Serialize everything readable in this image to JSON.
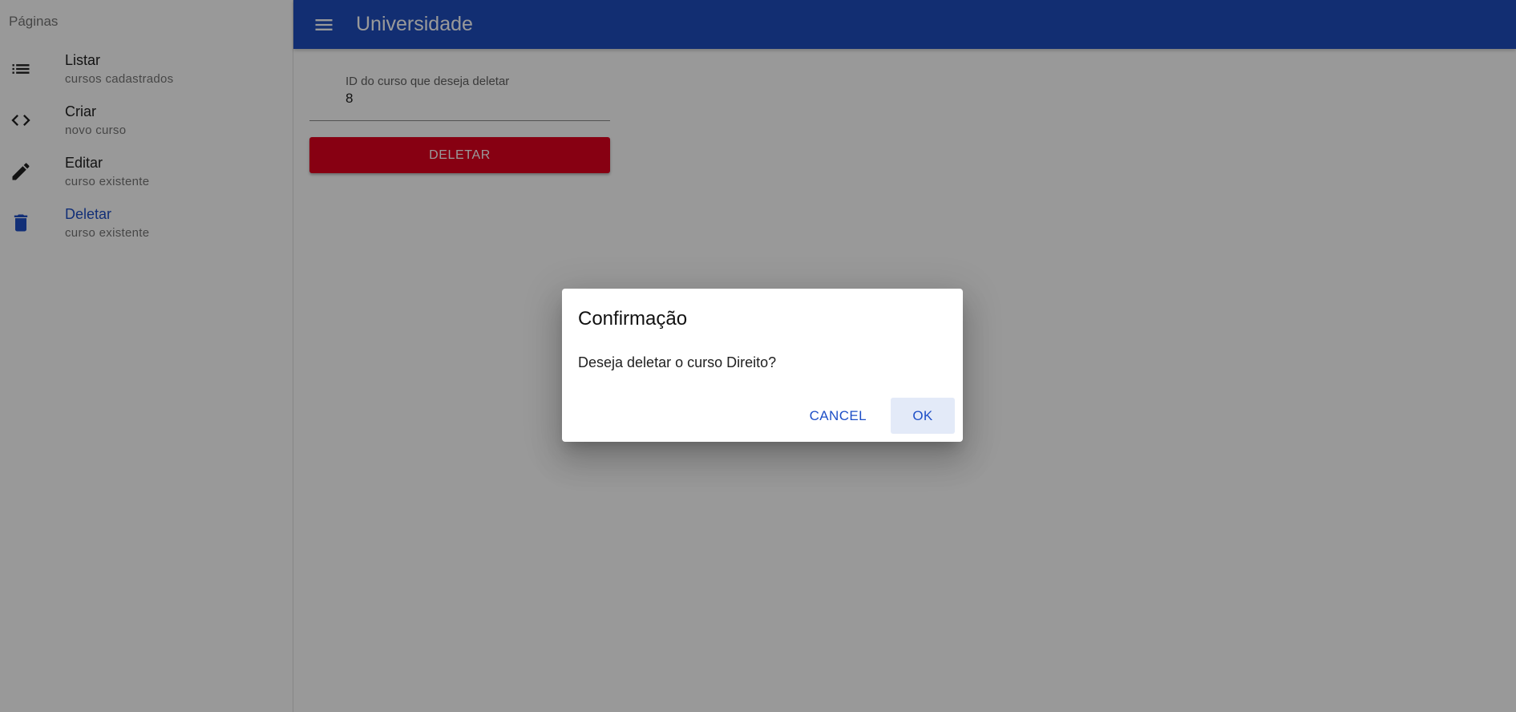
{
  "sidebar": {
    "subheader": "Páginas",
    "items": [
      {
        "label": "Listar",
        "sublabel": "cursos cadastrados",
        "icon": "list-icon"
      },
      {
        "label": "Criar",
        "sublabel": "novo curso",
        "icon": "code-icon"
      },
      {
        "label": "Editar",
        "sublabel": "curso existente",
        "icon": "pencil-icon"
      },
      {
        "label": "Deletar",
        "sublabel": "curso existente",
        "icon": "trash-icon",
        "active": true
      }
    ]
  },
  "appbar": {
    "title": "Universidade",
    "menu_icon": "menu-icon"
  },
  "form": {
    "id_label": "ID do curso que deseja deletar",
    "id_value": "8",
    "delete_label": "DELETAR"
  },
  "dialog": {
    "title": "Confirmação",
    "message": "Deseja deletar o curso Direito?",
    "cancel_label": "CANCEL",
    "ok_label": "OK"
  },
  "colors": {
    "primary": "#1f4ebf",
    "accent": "#1e4fc7",
    "danger": "#e1001e"
  }
}
